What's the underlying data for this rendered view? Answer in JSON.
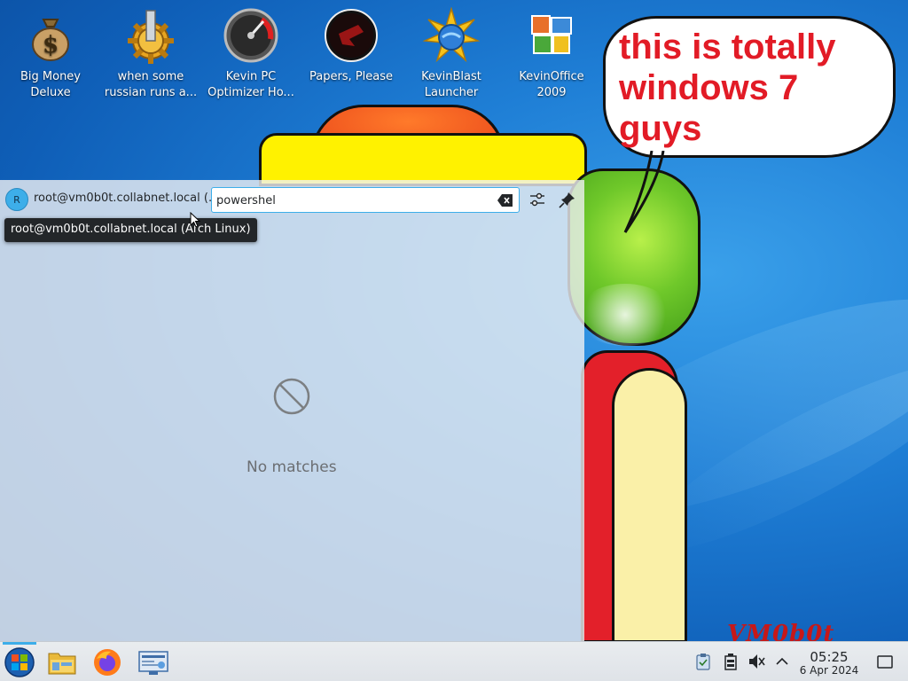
{
  "desktop": {
    "icons": [
      {
        "label": "Big Money\nDeluxe",
        "icon": "money-bag-icon"
      },
      {
        "label": "when some\nrussian runs a...",
        "icon": "gear-icon"
      },
      {
        "label": "Kevin PC\nOptimizer Ho...",
        "icon": "speedometer-icon"
      },
      {
        "label": "Papers, Please",
        "icon": "papers-please-icon"
      },
      {
        "label": "KevinBlast\nLauncher",
        "icon": "starburst-icon"
      },
      {
        "label": "KevinOffice\n2009",
        "icon": "office-logo-icon"
      }
    ],
    "bubble_text": "this is totally windows 7 guys",
    "watermark": "VM0b0t"
  },
  "krunner": {
    "avatar_letter": "R",
    "user_short": "root@vm0b0t.collabnet.local (...",
    "search_value": "powershel",
    "tooltip": "root@vm0b0t.collabnet.local (Arch Linux)",
    "no_matches": "No matches",
    "accent": "#3daee9"
  },
  "taskbar": {
    "items": [
      "start-orb-icon",
      "file-manager-icon",
      "firefox-icon",
      "system-settings-icon"
    ],
    "tray": [
      "clipboard-icon",
      "battery-icon",
      "volume-muted-icon",
      "chevron-up-icon",
      "show-desktop-icon"
    ],
    "clock": {
      "time": "05:25",
      "date": "6 Apr 2024"
    }
  }
}
